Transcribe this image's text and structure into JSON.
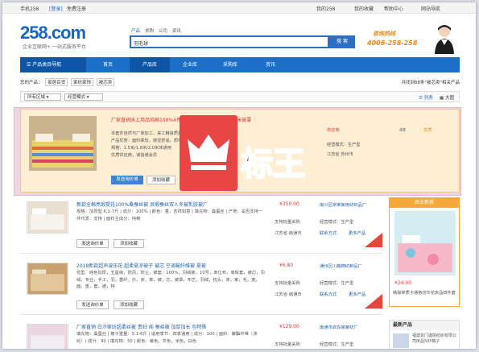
{
  "topbar": {
    "phone": "手机258",
    "login": "[登录]",
    "register": "免费注册",
    "my258": "我的258",
    "fav": "我的收藏",
    "help": "帮助中心",
    "sitenav": "网站导航"
  },
  "logo": {
    "text": "258.com",
    "slogan": "企业互联网+ 一站式服务平台"
  },
  "search": {
    "tabs": [
      "产品",
      "求购",
      "公司",
      "资讯"
    ],
    "value": "羽毛球",
    "button": "搜 索"
  },
  "hotline": {
    "label": "咨询热线",
    "number": "4006-258-258"
  },
  "nav": {
    "category": "产品类目导航",
    "items": [
      "首页",
      "产品库",
      "企业库",
      "采购库",
      "资讯"
    ]
  },
  "crumb": {
    "label": "您的产品：",
    "path": [
      "家居百货",
      "家纺家饰",
      "被芯类"
    ],
    "result": "共找到68条\"被芯类\"相关产品"
  },
  "filter": {
    "location": "所有区域",
    "mode": "经营模式",
    "list": "列表",
    "grid": "大图"
  },
  "ad": {
    "title": "厂家直销床上用品纯棉100%4件套 活性印花四件套1.5至2米被罩",
    "lines": [
      "本套件自然与厂家加工，来工精良质量好，大厂推荐采购",
      "产品优势：面料柔软，感觉舒适，质地优良，抗起球，环保，无甲醛",
      "规格：1.5米/1.8米/2.0米床通用",
      "优质供应商，诚信通会员"
    ],
    "buttons": [
      "发送询价单",
      "添加收藏"
    ],
    "status": "供应商",
    "mode": "经营模式：生产型",
    "loc": "江苏省 苏州市",
    "years": "4年",
    "badge_word": "标王",
    "price_tag": "优质"
  },
  "products": [
    {
      "title": "新款全棉亮缎提花100%桑蚕丝被 贡缎蚕丝双人冬被乳胶被厂",
      "desc": "规格：加厚型 6.1-7斤 | 成分：100% | 颜色：香，吉祥如意 | 填充物：桑蚕丝 | 产地：是否支持一件代发：支持 | 面料主成分：纯棉",
      "price": "¥350.00",
      "support": "支持批量采购",
      "loc": "江苏省-南通市",
      "shop": "南川区常荣家用纺织品厂",
      "mode": "经营模式：生产型",
      "contact": "联系方式",
      "more": "更多产品",
      "buttons": [
        "发送询价单",
        "添加收藏"
      ]
    },
    {
      "title": "2018新款超声波压花 超柔夏凉被子 被芯 空调被纤维被 夏被",
      "desc": "花型：纯色加厚，五星级，防风，防尘，被套：100%，羽绒被，10号，单位布，单板套，被芯，羽绒，专业，手工，羽，香纤，乐，床，单，被，芯，被罩，布艺，羽绒，枕头，床，家，毛，宽，面，重，套，被，特",
      "price": "¥6.80",
      "support": "支持批量采购",
      "loc": "江苏省-南通市",
      "shop": "通州区川鑫棉纺制品厂",
      "mode": "经营模式：生产型",
      "contact": "联系方式",
      "more": "更多产品",
      "buttons": [
        "发送询价单",
        "添加收藏"
      ]
    },
    {
      "title": "厂家直销 白汐家纺超柔丝被 贵妇 纯 蚕丝被 加厚加长 包特殊",
      "desc": "填充物：桑蚕丝 | 被子重量：5.1-6斤 | 适用季节：四季通用 | 成分：100 | 面料：聚酯纤维（涤纶）| 成分：90 | 填充物：50 | 颜色：紫色，灰色，米色，白色",
      "price": "¥129.00",
      "support": "支持批量采购",
      "loc": "江苏省-南通市",
      "shop": "南通市启东家家纺厂",
      "mode": "经营模式：生产型",
      "contact": "联系方式",
      "more": "更多产品",
      "buttons": [
        "发送询价单",
        "添加收藏"
      ]
    }
  ],
  "side": {
    "title": "商业新推",
    "price": "¥24.00",
    "caption": "韩版棉质卡通格纹印花床品四件套",
    "title2": "最新产品",
    "item2": "福建泉门莲院纺织有限公司床品50P格子"
  },
  "colors": {
    "brand": "#1767c2",
    "nav": "#1c6fc9",
    "accent": "#e94545",
    "orange": "#f4a93a"
  }
}
